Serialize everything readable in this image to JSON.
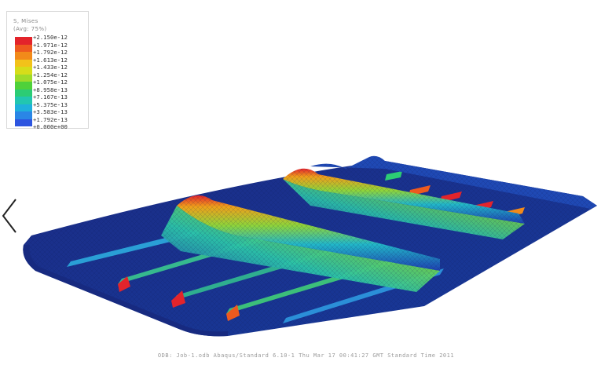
{
  "legend": {
    "title_line1": "S, Mises",
    "title_line2": "(Avg: 75%)",
    "entries": [
      {
        "label": "+2.150e-12",
        "color": "#e3242b"
      },
      {
        "label": "+1.971e-12",
        "color": "#ee5a1f"
      },
      {
        "label": "+1.792e-12",
        "color": "#f28a1a"
      },
      {
        "label": "+1.613e-12",
        "color": "#f2c21a"
      },
      {
        "label": "+1.433e-12",
        "color": "#d6dd1a"
      },
      {
        "label": "+1.254e-12",
        "color": "#9fdb2a"
      },
      {
        "label": "+1.075e-12",
        "color": "#4fd13a"
      },
      {
        "label": "+8.958e-13",
        "color": "#2ccc74"
      },
      {
        "label": "+7.167e-13",
        "color": "#22c6b0"
      },
      {
        "label": "+5.375e-13",
        "color": "#1fb0dc"
      },
      {
        "label": "+3.583e-13",
        "color": "#2a86e6"
      },
      {
        "label": "+1.792e-13",
        "color": "#2d55e0"
      },
      {
        "label": "+0.000e+00",
        "color": "#2a2fc8"
      }
    ]
  },
  "nav": {
    "prev_icon": "chevron-left-icon"
  },
  "footer": {
    "caption": "ODB: Job-1.odb   Abaqus/Standard 6.10-1   Thu Mar 17 00:41:27 GMT Standard Time 2011"
  },
  "colors": {
    "mesh_dark": "#1a2a7a",
    "mesh_mid": "#1f5fbf",
    "hot": "#e3242b"
  }
}
